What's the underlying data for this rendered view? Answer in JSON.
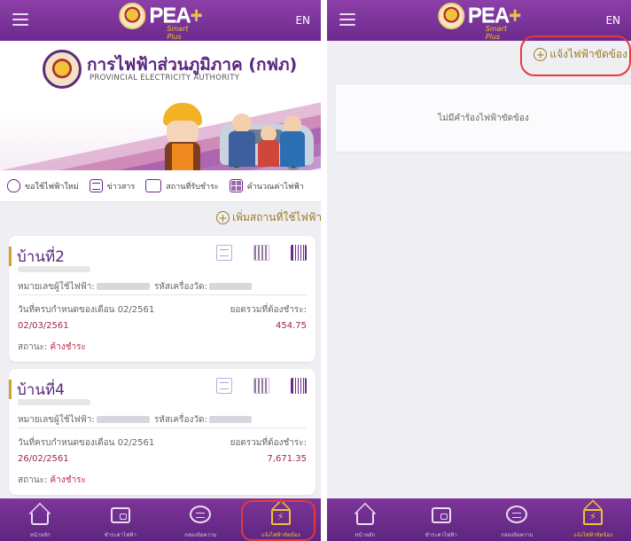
{
  "app": {
    "name": "PEA",
    "sub": "Smart Plus",
    "lang": "EN"
  },
  "banner": {
    "org_th": "การไฟฟ้าส่วนภูมิภาค (กฟภ)",
    "org_en": "PROVINCIAL ELECTRICITY AUTHORITY"
  },
  "menu": [
    {
      "label": "ขอใช้ไฟฟ้าใหม่",
      "icon": "lightbulb-icon"
    },
    {
      "label": "ข่าวสาร",
      "icon": "news-icon"
    },
    {
      "label": "สถานที่รับชำระ",
      "icon": "store-icon"
    },
    {
      "label": "คำนวณค่าไฟฟ้า",
      "icon": "calculator-icon"
    }
  ],
  "add_location": "เพิ่มสถานที่ใช้ไฟฟ้า",
  "cards": [
    {
      "title": "บ้านที่2",
      "ca_label": "หมายเลขผู้ใช้ไฟฟ้า:",
      "meter_label": "รหัสเครื่องวัด:",
      "due_label": "วันที่ครบกำหนดของเดือน 02/2561",
      "total_label": "ยอดรวมที่ต้องชำระ:",
      "due_date": "02/03/2561",
      "amount": "454.75",
      "status_label": "สถานะ:",
      "status_value": "ค้างชำระ"
    },
    {
      "title": "บ้านที่4",
      "ca_label": "หมายเลขผู้ใช้ไฟฟ้า:",
      "meter_label": "รหัสเครื่องวัด:",
      "due_label": "วันที่ครบกำหนดของเดือน 02/2561",
      "total_label": "ยอดรวมที่ต้องชำระ:",
      "due_date": "26/02/2561",
      "amount": "7,671.35",
      "status_label": "สถานะ:",
      "status_value": "ค้างชำระ"
    }
  ],
  "nav": [
    {
      "label": "หน้าหลัก",
      "icon": "home-icon"
    },
    {
      "label": "ชำระค่าไฟฟ้า",
      "icon": "wallet-icon"
    },
    {
      "label": "กล่องข้อความ",
      "icon": "message-icon"
    },
    {
      "label": "แจ้งไฟฟ้าขัดข้อง",
      "icon": "report-outage-icon"
    }
  ],
  "right": {
    "report_link": "แจ้งไฟฟ้าขัดข้อง",
    "empty_message": "ไม่มีคำร้องไฟฟ้าขัดข้อง"
  },
  "colors": {
    "header": "#6c2a8d",
    "accent": "#f0c232",
    "highlight": "#e43a3a",
    "due": "#a02845"
  }
}
